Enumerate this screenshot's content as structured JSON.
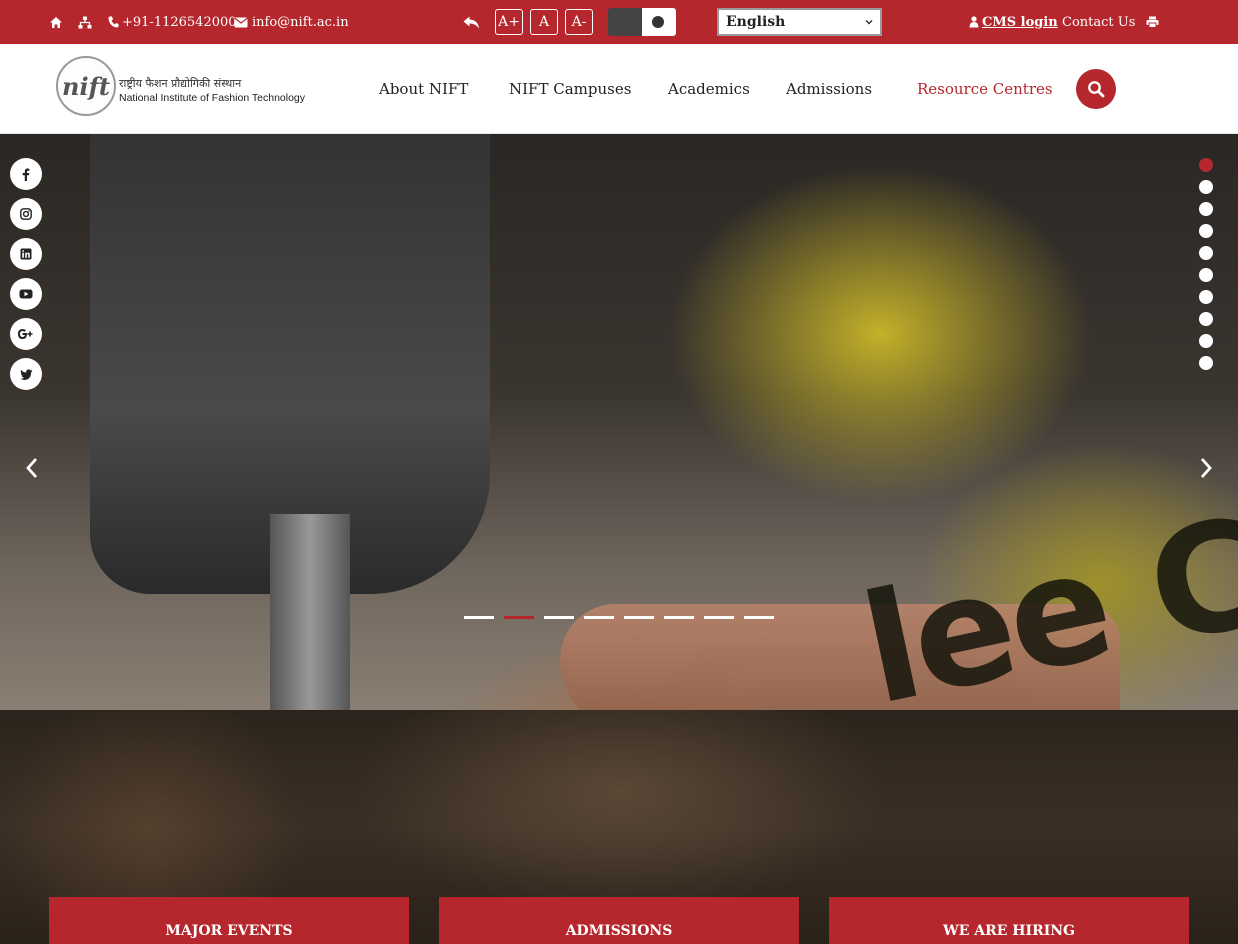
{
  "topbar": {
    "phone": "+91-1126542000",
    "email": "info@nift.ac.in",
    "font_increase": "A+",
    "font_normal": "A",
    "font_decrease": "A-",
    "language_selected": "English",
    "cms_login": "CMS login",
    "contact": "Contact Us",
    "icons": [
      "home-icon",
      "sitemap-icon",
      "phone-icon",
      "envelope-icon",
      "reply-icon",
      "contrast-toggle",
      "user-icon",
      "print-icon"
    ]
  },
  "header": {
    "logo_mark": "nift",
    "logo_hindi": "राष्ट्रीय फैशन प्रौद्योगिकी संस्थान",
    "logo_english": "National Institute of Fashion Technology",
    "nav": [
      {
        "label": "About NIFT"
      },
      {
        "label": "NIFT Campuses"
      },
      {
        "label": "Academics"
      },
      {
        "label": "Admissions"
      },
      {
        "label": "Resource Centres"
      }
    ]
  },
  "hero": {
    "shirt_print": "lee Coop",
    "social": [
      "facebook-icon",
      "instagram-icon",
      "linkedin-icon",
      "youtube-icon",
      "google-plus-icon",
      "twitter-icon"
    ],
    "vertical_dots_active": 0,
    "vertical_dots_count": 10,
    "indicator_active": 1,
    "indicator_count": 8
  },
  "cards": [
    {
      "label": "MAJOR EVENTS"
    },
    {
      "label": "ADMISSIONS"
    },
    {
      "label": "WE ARE HIRING"
    }
  ],
  "colors": {
    "brand": "#b5272d",
    "dark_toggle": "#444444"
  }
}
